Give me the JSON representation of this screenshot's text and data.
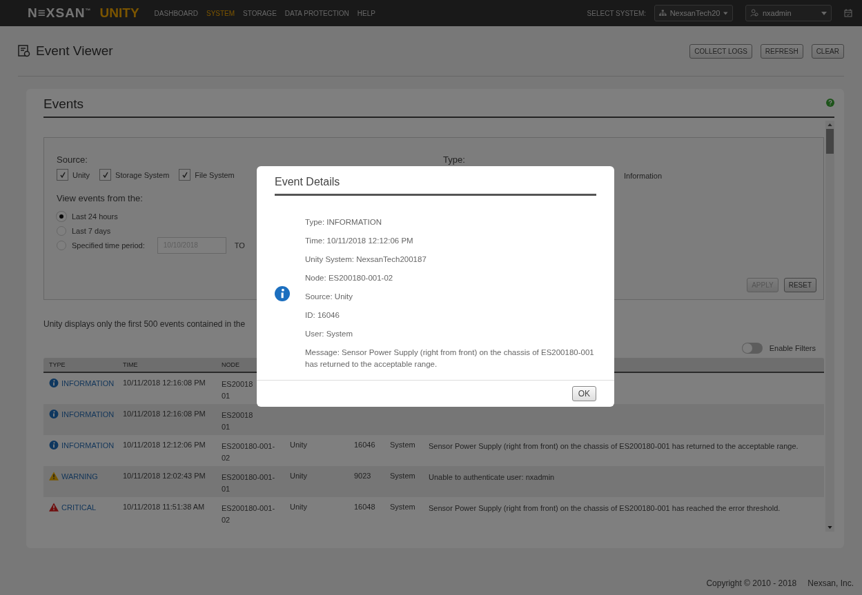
{
  "nav": {
    "logo": "N≡XSAN$^{™}$",
    "product": "UNITY",
    "menu": [
      {
        "label": "DASHBOARD",
        "selected": false
      },
      {
        "label": "SYSTEM",
        "selected": true
      },
      {
        "label": "STORAGE",
        "selected": false
      },
      {
        "label": "DATA PROTECTION",
        "selected": false
      },
      {
        "label": "HELP",
        "selected": false
      }
    ],
    "select_label": "SELECT SYSTEM:",
    "system": "NexsanTech20",
    "user": "nxadmin"
  },
  "page": {
    "title": "Event Viewer",
    "buttons": [
      "COLLECT LOGS",
      "REFRESH",
      "CLEAR"
    ]
  },
  "events": {
    "title": "Events",
    "filters": {
      "source_label": "Source:",
      "sources": [
        {
          "label": "Unity",
          "checked": true
        },
        {
          "label": "Storage System",
          "checked": true
        },
        {
          "label": "File System",
          "checked": true
        }
      ],
      "type_label": "Type:",
      "type_option": "Information",
      "view_label": "View events from the:",
      "ranges": [
        {
          "label": "Last 24 hours",
          "selected": true
        },
        {
          "label": "Last 7 days",
          "selected": false
        },
        {
          "label": "Specified time period:",
          "selected": false
        }
      ],
      "date_from": {
        "placeholder": "10/10/2018"
      },
      "to_label": "TO",
      "buttons": [
        {
          "label": "APPLY",
          "disabled": true
        },
        {
          "label": "RESET",
          "disabled": false
        }
      ]
    },
    "notice": "Unity displays only the first 500 events contained in the",
    "enable_filters": {
      "label": "Enable Filters",
      "on": false
    },
    "columns": [
      "TYPE",
      "TIME",
      "NODE"
    ],
    "rows": [
      {
        "kind": "information",
        "type": "INFORMATION",
        "time": "10/11/2018 12:16:08 PM",
        "node": [
          "ES20018",
          "01"
        ]
      },
      {
        "kind": "information",
        "type": "INFORMATION",
        "time": "10/11/2018 12:16:08 PM",
        "node": [
          "ES20018",
          "01"
        ]
      },
      {
        "kind": "information",
        "type": "INFORMATION",
        "time": "10/11/2018 12:12:06 PM",
        "node": [
          "ES200180-001-",
          "02"
        ],
        "source": "Unity",
        "id": "16046",
        "user": "System",
        "message": "Sensor Power Supply (right from front) on the chassis of ES200180-001 has returned to the acceptable range."
      },
      {
        "kind": "warning",
        "type": "WARNING",
        "time": "10/11/2018 12:02:43 PM",
        "node": [
          "ES200180-001-",
          "01"
        ],
        "source": "Unity",
        "id": "9023",
        "user": "System",
        "message": "Unable to authenticate user: nxadmin"
      },
      {
        "kind": "critical",
        "type": "CRITICAL",
        "time": "10/11/2018 11:51:38 AM",
        "node": [
          "ES200180-001-",
          "02"
        ],
        "source": "Unity",
        "id": "16048",
        "user": "System",
        "message": "Sensor Power Supply (right from front) on the chassis of ES200180-001 has reached the error threshold."
      }
    ]
  },
  "modal": {
    "title": "Event Details",
    "kind": "information",
    "details": [
      "Type: INFORMATION",
      "Time: 10/11/2018 12:12:06 PM",
      "Unity System: NexsanTech200187",
      "Node: ES200180-001-02",
      "Source: Unity",
      "ID: 16046",
      "User: System",
      "Message: Sensor Power Supply (right from front) on the chassis of ES200180-001 has returned to the acceptable range."
    ],
    "button": "OK"
  },
  "footer": {
    "copyright": "Copyright © 2010 - 2018",
    "company": "Nexsan, Inc."
  }
}
